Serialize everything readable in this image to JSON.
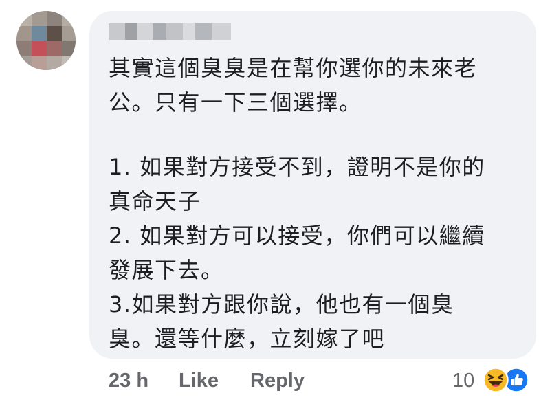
{
  "comment": {
    "author_name_redacted": true,
    "body_lines": [
      "其實這個臭臭是在幫你選你的未來老",
      "公。只有一下三個選擇。",
      "",
      "1. 如果對方接受不到，證明不是你的",
      "真命天子",
      "2. 如果對方可以接受，你們可以繼續",
      "發展下去。",
      "3.如果對方跟你說，他也有一個臭",
      "臭。還等什麼，立刻嫁了吧"
    ],
    "timestamp": "23 h",
    "like_label": "Like",
    "reply_label": "Reply",
    "reaction_count": "10",
    "reaction_icons": [
      "haha-reaction-icon",
      "like-reaction-icon"
    ],
    "colors": {
      "bubble": "#f0f2f5",
      "text": "#1c1e21",
      "meta": "#65676b",
      "like_blue": "#1877f2",
      "haha_yellow": "#f7b928"
    }
  }
}
